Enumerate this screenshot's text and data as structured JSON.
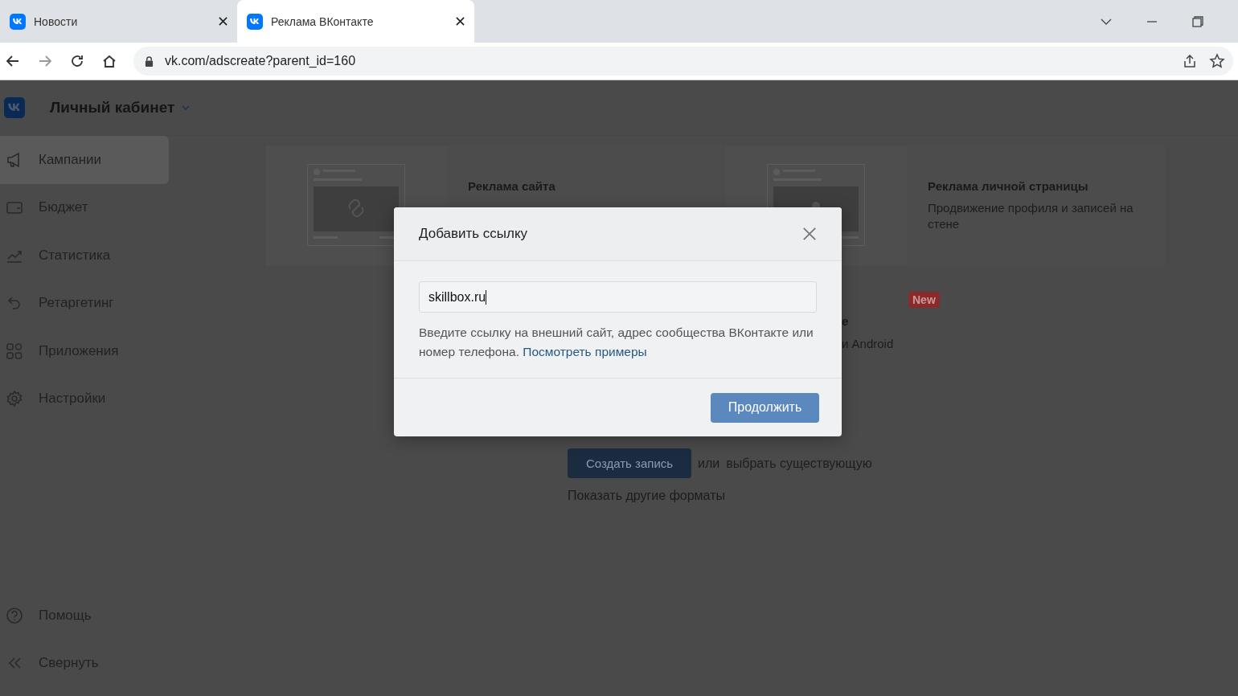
{
  "browser": {
    "tabs": [
      {
        "title": "Новости",
        "selected": false
      },
      {
        "title": "Реклама ВКонтакте",
        "selected": true
      }
    ],
    "url": "vk.com/adscreate?parent_id=160"
  },
  "header": {
    "title": "Личный кабинет"
  },
  "sidebar": {
    "items": [
      {
        "label": "Кампании",
        "selected": true
      },
      {
        "label": "Бюджет",
        "selected": false
      },
      {
        "label": "Статистика",
        "selected": false
      },
      {
        "label": "Ретаргетинг",
        "selected": false
      },
      {
        "label": "Приложения",
        "selected": false
      },
      {
        "label": "Настройки",
        "selected": false
      }
    ],
    "bottom_items": [
      {
        "label": "Помощь"
      },
      {
        "label": "Свернуть"
      }
    ]
  },
  "formats": [
    {
      "title": "Реклама сайта"
    },
    {
      "title": "Реклама личной страницы",
      "description": "Продвижение профиля и записей на стене"
    }
  ],
  "partial_format": {
    "badge": "New",
    "title_fragment": "е",
    "description_fragment": "и Android"
  },
  "actions": {
    "create_button": "Создать запись",
    "or_text": "или",
    "choose_link": "выбрать существующую",
    "more_formats": "Показать другие форматы"
  },
  "modal": {
    "title": "Добавить ссылку",
    "input_value": "skillbox.ru",
    "hint": "Введите ссылку на внешний сайт, адрес сообщества ВКонтакте или номер телефона.",
    "hint_link": "Посмотреть примеры",
    "continue_button": "Продолжить"
  }
}
